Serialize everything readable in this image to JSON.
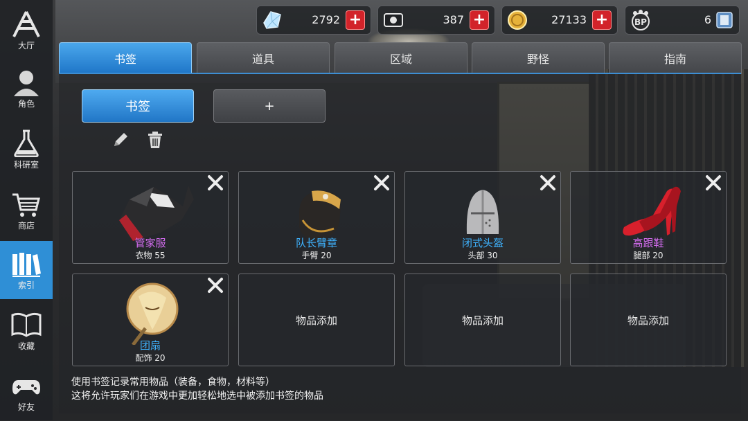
{
  "nav": {
    "items": [
      {
        "label": "大厅",
        "icon": "lobby-icon"
      },
      {
        "label": "角色",
        "icon": "character-icon"
      },
      {
        "label": "科研室",
        "icon": "flask-icon"
      },
      {
        "label": "商店",
        "icon": "cart-icon"
      },
      {
        "label": "索引",
        "icon": "books-icon",
        "active": true
      },
      {
        "label": "收藏",
        "icon": "open-book-icon"
      },
      {
        "label": "好友",
        "icon": "gamepad-icon"
      }
    ]
  },
  "currency": {
    "crystal": "2792",
    "ticket": "387",
    "gold": "27133",
    "bp": "6"
  },
  "tabs": [
    "书签",
    "道具",
    "区域",
    "野怪",
    "指南"
  ],
  "bookmark_button": "书签",
  "add_button": "+",
  "slots": [
    {
      "name": "管家服",
      "name_color": "#d46cf0",
      "sub": "衣物 55",
      "art": "butler-coat"
    },
    {
      "name": "队长臂章",
      "name_color": "#3fb3ff",
      "sub": "手臂 20",
      "art": "armband"
    },
    {
      "name": "闭式头盔",
      "name_color": "#3fb3ff",
      "sub": "头部 30",
      "art": "helmet"
    },
    {
      "name": "高跟鞋",
      "name_color": "#d46cf0",
      "sub": "腿部 20",
      "art": "heels"
    },
    {
      "name": "团扇",
      "name_color": "#3fb3ff",
      "sub": "配饰 20",
      "art": "fan"
    },
    {
      "empty": "物品添加"
    },
    {
      "empty": "物品添加"
    },
    {
      "empty": "物品添加"
    }
  ],
  "description": {
    "line1": "使用书签记录常用物品（装备，食物，材料等）",
    "line2": "这将允许玩家们在游戏中更加轻松地选中被添加书签的物品"
  },
  "colors": {
    "accent": "#2f8fd6",
    "plus_red": "#d2232a"
  }
}
